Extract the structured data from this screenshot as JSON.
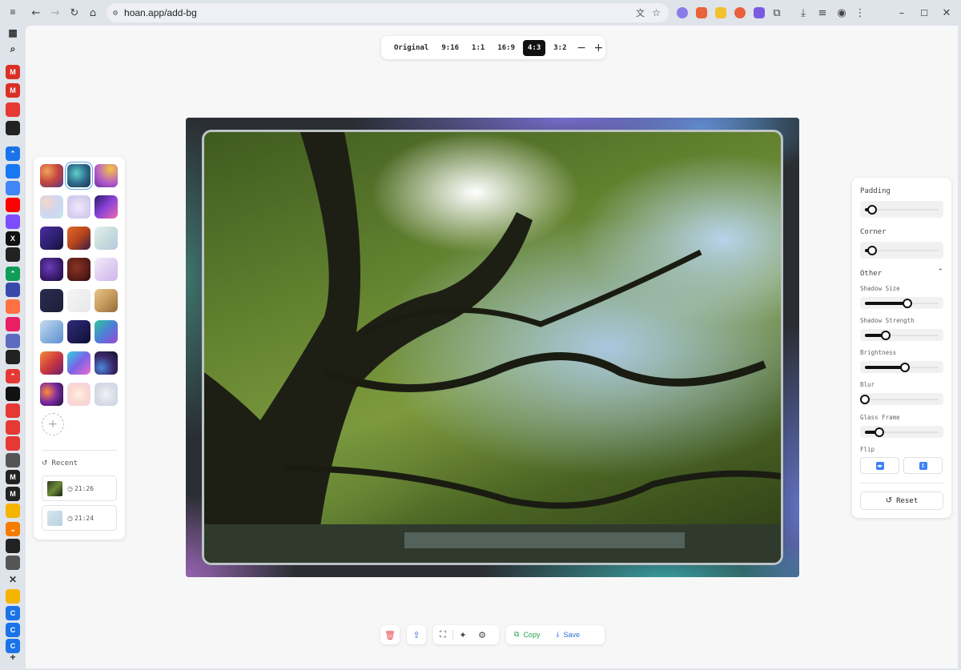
{
  "browser": {
    "url": "hoan.app/add-bg",
    "sidebar_icons": [
      "menu-icon",
      "apps-icon",
      "search-icon",
      "gmail-icon",
      "gmail-icon",
      "music-icon",
      "threads-icon",
      "collapse-icon",
      "facebook-icon",
      "google-icon",
      "youtube-icon",
      "messenger-icon",
      "x-icon",
      "threads-icon",
      "collapse-icon",
      "hourglass-icon",
      "sparkle-icon",
      "heart-icon",
      "mastodon-icon",
      "github-icon",
      "collapse-icon",
      "tiktok-icon",
      "youtube-icon",
      "youtube-icon",
      "youtube-icon",
      "globe-icon",
      "m-icon",
      "m-icon",
      "chat-icon",
      "expand-icon",
      "github-icon",
      "app-icon",
      "close-icon",
      "badge-icon",
      "c-icon",
      "c-icon",
      "c-icon",
      "add-icon"
    ]
  },
  "ratio_bar": {
    "options": [
      "Original",
      "9:16",
      "1:1",
      "16:9",
      "4:3",
      "3:2"
    ],
    "active": "4:3",
    "zoom_out": "−",
    "zoom_in": "+"
  },
  "backgrounds": {
    "selected_index": 1,
    "swatches": [
      "warm-mesh",
      "teal-mesh",
      "purple-gold",
      "pastel-mesh",
      "lavender-mist",
      "violet-pink",
      "indigo-night",
      "rust-ember",
      "mint-haze",
      "deep-purple",
      "maroon",
      "lilac-fade",
      "midnight",
      "light-gray",
      "gold-beige",
      "sky-blue",
      "navy-night",
      "teal-purple",
      "sunset-red",
      "neon-mix",
      "dark-aurora",
      "dark-glow",
      "peach-blur",
      "silver-blur"
    ],
    "colors": [
      "#d96b55",
      "#3b8c9c",
      "#b25acb",
      "#d9d8ee",
      "#d8d0f0",
      "#8c43d9",
      "#2a1f6b",
      "#b6451b",
      "#c7dcdc",
      "#3a1a6e",
      "#5a1d18",
      "#e0cef2",
      "#1c1e38",
      "#eeeeef",
      "#c89b5e",
      "#8db4e0",
      "#1d1b52",
      "#4d7fd6",
      "#ce3a3e",
      "#7a63e6",
      "#3c2a6c",
      "#3a1b5c",
      "#fbd9cf",
      "#d8dbe6"
    ],
    "add_label": "+"
  },
  "recent": {
    "title": "Recent",
    "items": [
      {
        "time": "21:26"
      },
      {
        "time": "21:24"
      }
    ]
  },
  "settings": {
    "padding_label": "Padding",
    "padding_value": 0.1,
    "corner_label": "Corner",
    "corner_value": 0.1,
    "other_label": "Other",
    "shadow_size_label": "Shadow Size",
    "shadow_size_value": 0.58,
    "shadow_strength_label": "Shadow Strength",
    "shadow_strength_value": 0.28,
    "brightness_label": "Brightness",
    "brightness_value": 0.54,
    "blur_label": "Blur",
    "blur_value": 0.0,
    "glass_frame_label": "Glass Frame",
    "glass_frame_value": 0.2,
    "flip_label": "Flip",
    "reset_label": "Reset"
  },
  "toolbar": {
    "copy_label": "Copy",
    "save_label": "Save",
    "accent_copy": "#22a04b",
    "accent_save": "#2f6fd6",
    "accent_delete": "#e5484d"
  }
}
